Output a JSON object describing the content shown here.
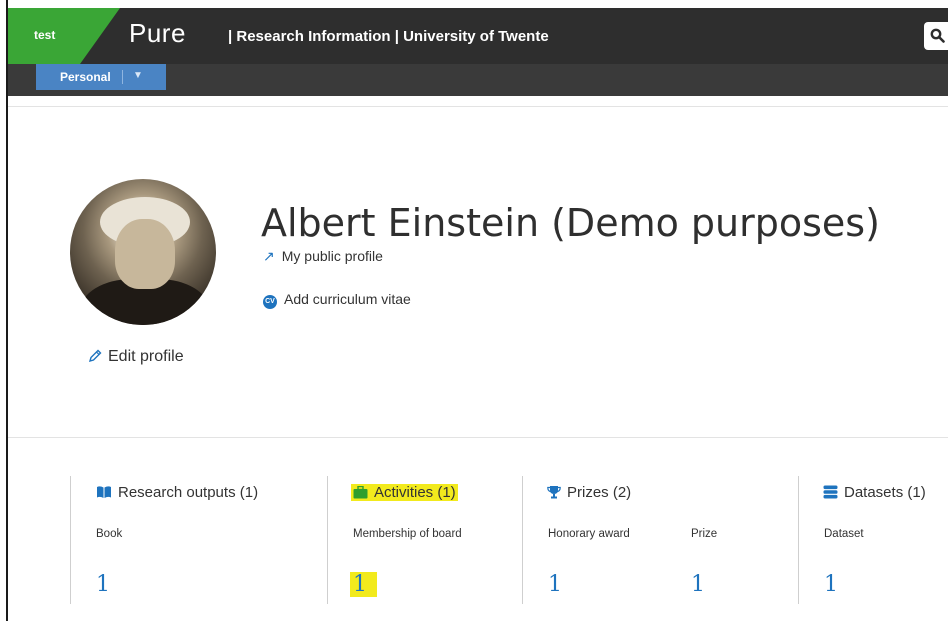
{
  "topbar": {
    "env_label": "test",
    "logo": "Pure",
    "title": "| Research Information | University of Twente"
  },
  "nav": {
    "tab_label": "Personal"
  },
  "profile": {
    "name": "Albert Einstein (Demo purposes)",
    "public_profile_link": "My public profile",
    "add_cv_link": "Add curriculum vitae",
    "cv_badge": "CV",
    "edit_profile": "Edit profile"
  },
  "stats": {
    "research_outputs": {
      "title": "Research outputs (1)",
      "items": [
        {
          "label": "Book",
          "value": "1"
        }
      ]
    },
    "activities": {
      "title": "Activities (1)",
      "items": [
        {
          "label": "Membership of board",
          "value": "1"
        }
      ]
    },
    "prizes": {
      "title": "Prizes (2)",
      "items": [
        {
          "label": "Honorary award",
          "value": "1"
        },
        {
          "label": "Prize",
          "value": "1"
        }
      ]
    },
    "datasets": {
      "title": "Datasets (1)",
      "items": [
        {
          "label": "Dataset",
          "value": "1"
        }
      ]
    }
  },
  "colors": {
    "env_green": "#3aa636",
    "header_dark": "#2e2e2e",
    "tab_blue": "#4a84c4",
    "link_blue": "#1e73be",
    "highlight_yellow": "#f2ea1d",
    "activities_icon_green": "#2e9e2e"
  },
  "icons": {
    "search": "search-icon",
    "arrow": "external-arrow-icon",
    "pencil": "pencil-icon",
    "book": "book-icon",
    "briefcase": "briefcase-icon",
    "trophy": "trophy-icon",
    "database": "database-icon"
  }
}
